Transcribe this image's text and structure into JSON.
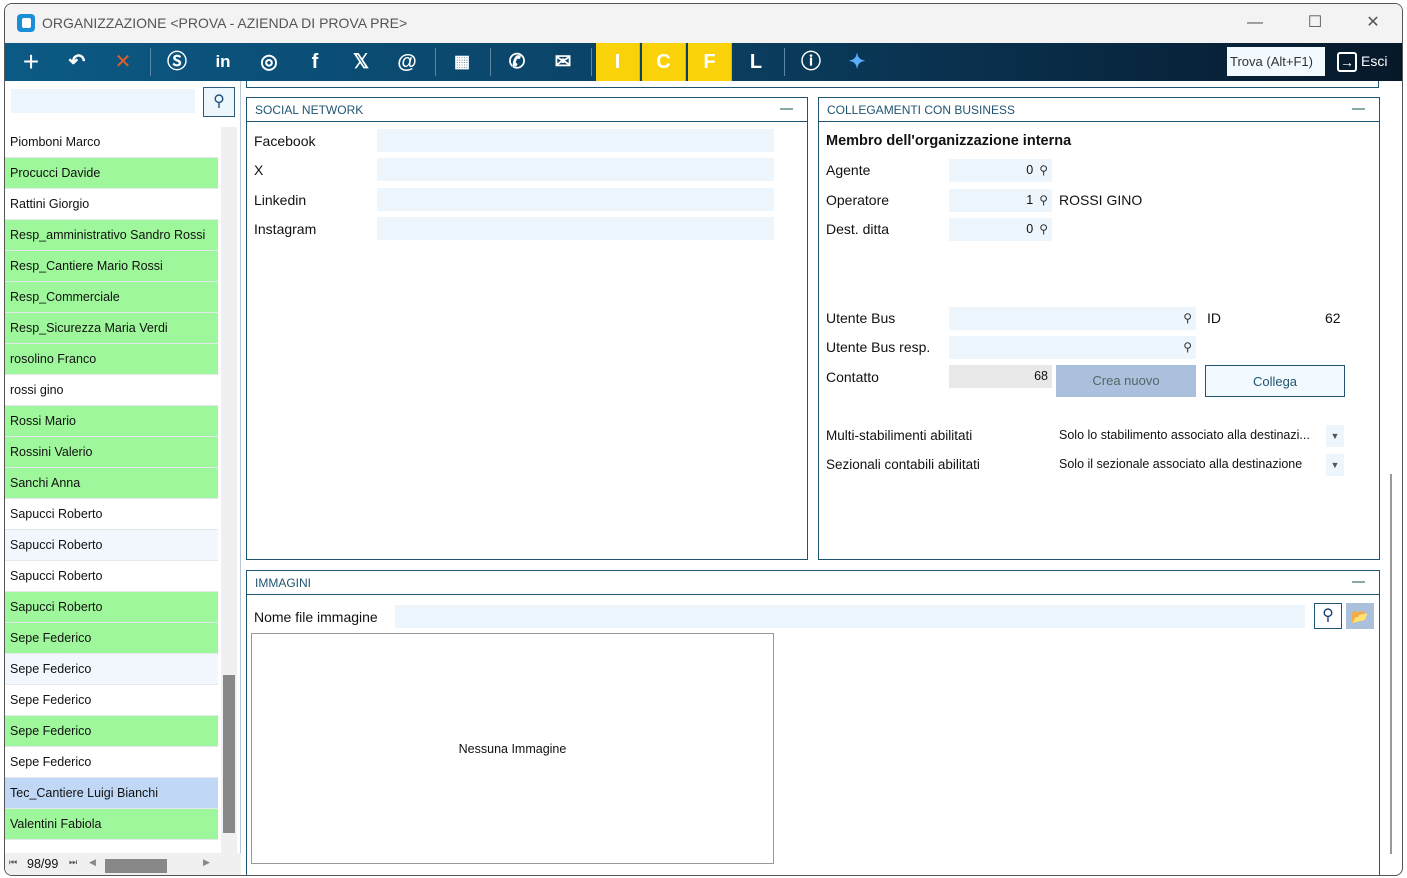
{
  "window": {
    "title": "ORGANIZZAZIONE <PROVA - AZIENDA DI PROVA PRE>",
    "minimize": "—",
    "maximize": "☐",
    "close": "✕"
  },
  "toolbar": {
    "letters": [
      "I",
      "C",
      "F",
      "L"
    ],
    "find_label": "Trova (Alt+F1)",
    "exit_label": "Esci",
    "colors": {
      "accent": "#f9d20a",
      "bar": "#0b4f78"
    }
  },
  "sidebar": {
    "search_placeholder": "",
    "items": [
      {
        "label": "Piomboni Marco",
        "state": "w"
      },
      {
        "label": "Procucci Davide",
        "state": "g"
      },
      {
        "label": "Rattini  Giorgio",
        "state": "w"
      },
      {
        "label": "Resp_amministrativo Sandro Rossi",
        "state": "g"
      },
      {
        "label": "Resp_Cantiere Mario Rossi",
        "state": "g"
      },
      {
        "label": "Resp_Commerciale",
        "state": "g"
      },
      {
        "label": "Resp_Sicurezza Maria Verdi",
        "state": "g"
      },
      {
        "label": "rosolino Franco",
        "state": "g"
      },
      {
        "label": "rossi gino",
        "state": "w"
      },
      {
        "label": "Rossi Mario",
        "state": "g"
      },
      {
        "label": "Rossini Valerio",
        "state": "g"
      },
      {
        "label": "Sanchi Anna",
        "state": "g"
      },
      {
        "label": "Sapucci Roberto",
        "state": "w"
      },
      {
        "label": "Sapucci Roberto",
        "state": "l"
      },
      {
        "label": "Sapucci Roberto",
        "state": "w"
      },
      {
        "label": "Sapucci Roberto",
        "state": "g"
      },
      {
        "label": "Sepe Federico",
        "state": "g"
      },
      {
        "label": "Sepe Federico",
        "state": "l"
      },
      {
        "label": "Sepe Federico",
        "state": "w"
      },
      {
        "label": "Sepe Federico",
        "state": "g"
      },
      {
        "label": "Sepe Federico",
        "state": "w"
      },
      {
        "label": "Tec_Cantiere Luigi Bianchi",
        "state": "s"
      },
      {
        "label": "Valentini Fabiola",
        "state": "g"
      }
    ],
    "pager": "98/99"
  },
  "social": {
    "title": "SOCIAL NETWORK",
    "fields": [
      {
        "label": "Facebook",
        "value": ""
      },
      {
        "label": "X",
        "value": ""
      },
      {
        "label": "Linkedin",
        "value": ""
      },
      {
        "label": "Instagram",
        "value": ""
      }
    ]
  },
  "business": {
    "title": "COLLEGAMENTI CON BUSINESS",
    "subtitle": "Membro dell'organizzazione interna",
    "agente": {
      "label": "Agente",
      "value": "0"
    },
    "operatore": {
      "label": "Operatore",
      "value": "1",
      "name": "ROSSI GINO"
    },
    "dest": {
      "label": "Dest. ditta",
      "value": "0"
    },
    "utente_bus": {
      "label": "Utente Bus",
      "value": ""
    },
    "id": {
      "label": "ID",
      "value": "62"
    },
    "utente_bus_resp": {
      "label": "Utente Bus resp.",
      "value": ""
    },
    "contatto": {
      "label": "Contatto",
      "value": "68"
    },
    "crea_nuovo": "Crea nuovo",
    "collega": "Collega",
    "multi": {
      "label": "Multi-stabilimenti abilitati",
      "value": "Solo lo stabilimento associato alla destinazi..."
    },
    "sezionali": {
      "label": "Sezionali contabili abilitati",
      "value": "Solo il sezionale associato alla destinazione"
    }
  },
  "images": {
    "title": "IMMAGINI",
    "file_label": "Nome file immagine",
    "file_value": "",
    "empty": "Nessuna Immagine"
  }
}
